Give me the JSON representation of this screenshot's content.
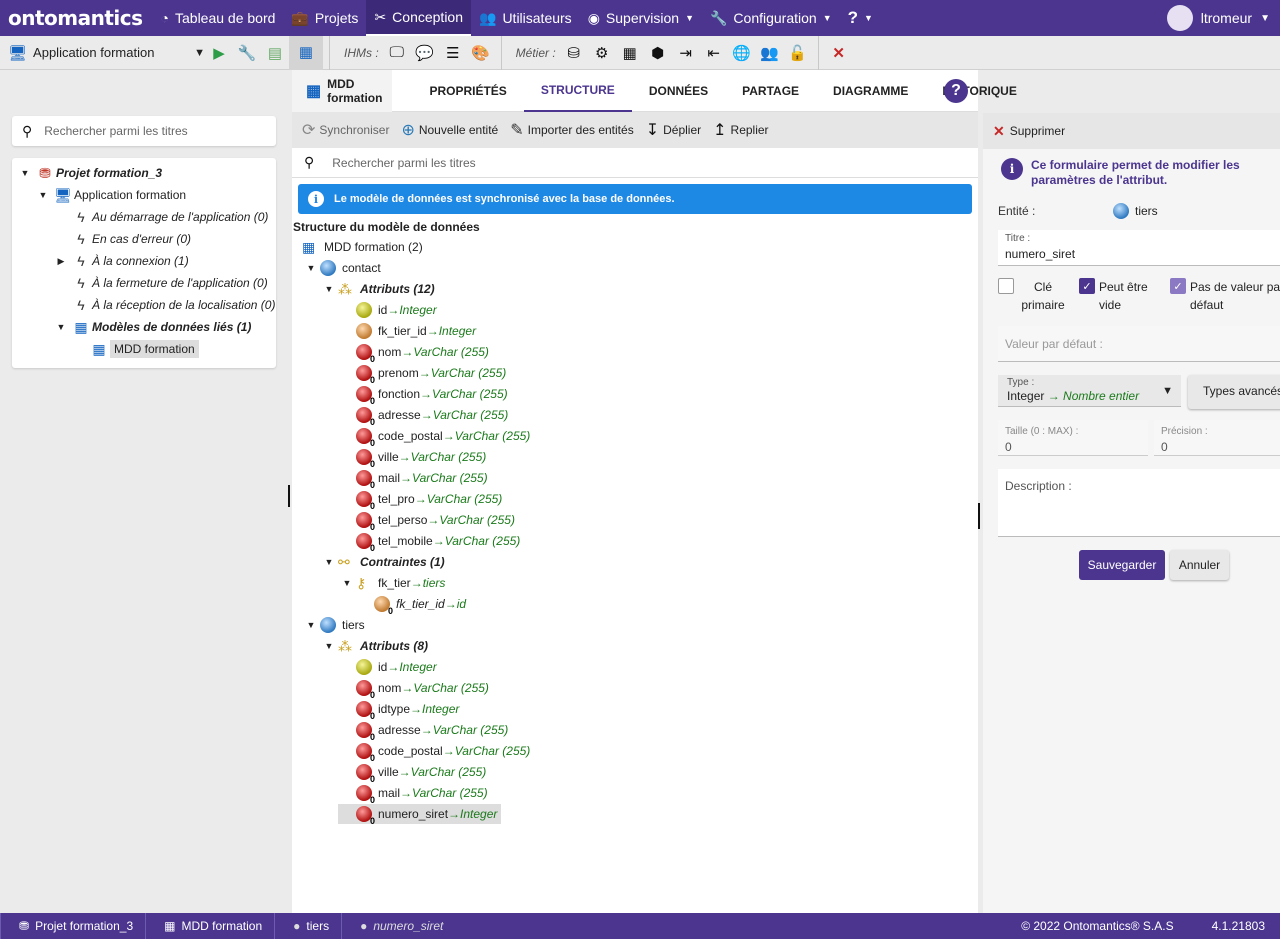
{
  "topbar": {
    "logo": "ontomantics",
    "nav": [
      {
        "label": "Tableau de bord",
        "icon": "dashboard-icon"
      },
      {
        "label": "Projets",
        "icon": "briefcase-icon"
      },
      {
        "label": "Conception",
        "icon": "tools-icon",
        "active": true
      },
      {
        "label": "Utilisateurs",
        "icon": "users-icon"
      },
      {
        "label": "Supervision",
        "icon": "eye-icon",
        "dropdown": true
      },
      {
        "label": "Configuration",
        "icon": "wrench-icon",
        "dropdown": true
      },
      {
        "label": "?",
        "icon": "help-icon",
        "dropdown": true
      }
    ],
    "user": "ltromeur"
  },
  "toolbar": {
    "app_select": "Application formation",
    "ihms_label": "IHMs :",
    "metier_label": "Métier :"
  },
  "left": {
    "search_placeholder": "Rechercher parmi les titres",
    "tree": [
      {
        "label": "Projet formation_3",
        "depth": 0,
        "arrow": "▼",
        "italic": true,
        "bold": true
      },
      {
        "label": "Application formation",
        "depth": 1,
        "arrow": "▼"
      },
      {
        "label": "Au démarrage de l'application (0)",
        "depth": 2,
        "italic": true
      },
      {
        "label": "En cas d'erreur (0)",
        "depth": 2,
        "italic": true
      },
      {
        "label": "À la connexion (1)",
        "depth": 2,
        "arrow": "▶",
        "italic": true
      },
      {
        "label": "À la fermeture de l'application (0)",
        "depth": 2,
        "italic": true
      },
      {
        "label": "À la réception de la localisation (0)",
        "depth": 2,
        "italic": true
      },
      {
        "label": "Modèles de données liés (1)",
        "depth": 2,
        "arrow": "▼",
        "italic": true,
        "bold": true
      },
      {
        "label": "MDD formation",
        "depth": 3,
        "selected": true
      }
    ]
  },
  "mid": {
    "crumb": "MDD formation",
    "tabs": [
      "PROPRIÉTÉS",
      "STRUCTURE",
      "DONNÉES",
      "PARTAGE",
      "DIAGRAMME",
      "HISTORIQUE"
    ],
    "active_tab": "STRUCTURE",
    "actions": [
      "Synchroniser",
      "Nouvelle entité",
      "Importer des entités",
      "Déplier",
      "Replier"
    ],
    "search_placeholder": "Rechercher parmi les titres",
    "info": "Le modèle de données est synchronisé avec la base de données.",
    "title": "Structure du modèle de données",
    "tree": [
      {
        "label": "MDD formation (2)",
        "depth": 0,
        "icon": "mdd"
      },
      {
        "label": "contact",
        "depth": 0,
        "arrow": "▼",
        "icon": "entity"
      },
      {
        "label": "Attributs (12)",
        "depth": 1,
        "arrow": "▼",
        "icon": "attrs",
        "italic": true,
        "bold": true
      },
      {
        "label": "id",
        "type": "Integer",
        "depth": 2,
        "icon": "pk"
      },
      {
        "label": "fk_tier_id",
        "type": "Integer",
        "depth": 2,
        "icon": "fk"
      },
      {
        "label": "nom",
        "type": "VarChar (255)",
        "depth": 2,
        "icon": "attr"
      },
      {
        "label": "prenom",
        "type": "VarChar (255)",
        "depth": 2,
        "icon": "attr"
      },
      {
        "label": "fonction",
        "type": "VarChar (255)",
        "depth": 2,
        "icon": "attr"
      },
      {
        "label": "adresse",
        "type": "VarChar (255)",
        "depth": 2,
        "icon": "attr"
      },
      {
        "label": "code_postal",
        "type": "VarChar (255)",
        "depth": 2,
        "icon": "attr"
      },
      {
        "label": "ville",
        "type": "VarChar (255)",
        "depth": 2,
        "icon": "attr"
      },
      {
        "label": "mail",
        "type": "VarChar (255)",
        "depth": 2,
        "icon": "attr"
      },
      {
        "label": "tel_pro",
        "type": "VarChar (255)",
        "depth": 2,
        "icon": "attr"
      },
      {
        "label": "tel_perso",
        "type": "VarChar (255)",
        "depth": 2,
        "icon": "attr"
      },
      {
        "label": "tel_mobile",
        "type": "VarChar (255)",
        "depth": 2,
        "icon": "attr"
      },
      {
        "label": "Contraintes (1)",
        "depth": 1,
        "arrow": "▼",
        "icon": "constraints",
        "italic": true,
        "bold": true
      },
      {
        "label": "fk_tier ",
        "type": "tiers",
        "depth": 2,
        "arrow": "▼",
        "icon": "key"
      },
      {
        "label": "fk_tier_id",
        "type": "id",
        "depth": 3,
        "icon": "fk",
        "italic": true
      },
      {
        "label": "tiers",
        "depth": 0,
        "arrow": "▼",
        "icon": "entity"
      },
      {
        "label": "Attributs (8)",
        "depth": 1,
        "arrow": "▼",
        "icon": "attrs",
        "italic": true,
        "bold": true
      },
      {
        "label": "id",
        "type": "Integer",
        "depth": 2,
        "icon": "pk"
      },
      {
        "label": "nom",
        "type": "VarChar (255)",
        "depth": 2,
        "icon": "attr"
      },
      {
        "label": "idtype",
        "type": "Integer",
        "depth": 2,
        "icon": "attr"
      },
      {
        "label": "adresse",
        "type": "VarChar (255)",
        "depth": 2,
        "icon": "attr"
      },
      {
        "label": "code_postal",
        "type": "VarChar (255)",
        "depth": 2,
        "icon": "attr"
      },
      {
        "label": "ville",
        "type": "VarChar (255)",
        "depth": 2,
        "icon": "attr"
      },
      {
        "label": "mail",
        "type": "VarChar (255)",
        "depth": 2,
        "icon": "attr"
      },
      {
        "label": "numero_siret",
        "type": "Integer",
        "depth": 2,
        "icon": "attr",
        "selected": true
      }
    ]
  },
  "right": {
    "delete": "Supprimer",
    "info": "Ce formulaire permet de modifier les paramètres de l'attribut.",
    "entity_label": "Entité :",
    "entity": "tiers",
    "title_label": "Titre :",
    "title": "numero_siret",
    "cb_pk": "Clé primaire",
    "cb_pk_checked": false,
    "cb_null": "Peut être vide",
    "cb_null_checked": true,
    "cb_nodefault": "Pas de valeur par défaut",
    "cb_nodefault_checked": true,
    "default_label": "Valeur par défaut :",
    "type_label": "Type :",
    "type_value": "Integer",
    "type_desc": "Nombre entier",
    "advanced": "Types avancés",
    "size_label": "Taille (0 : MAX) :",
    "size": "0",
    "precision_label": "Précision :",
    "precision": "0",
    "description_label": "Description :",
    "save": "Sauvegarder",
    "cancel": "Annuler"
  },
  "footer": {
    "crumbs": [
      "Projet formation_3",
      "MDD formation",
      "tiers",
      "numero_siret"
    ],
    "copyright": "© 2022 Ontomantics® S.A.S",
    "version": "4.1.21803"
  },
  "colors": {
    "brand": "#4b358f",
    "info": "#1e88e5",
    "type_green": "#1a7a1a",
    "delete_red": "#c62828"
  }
}
